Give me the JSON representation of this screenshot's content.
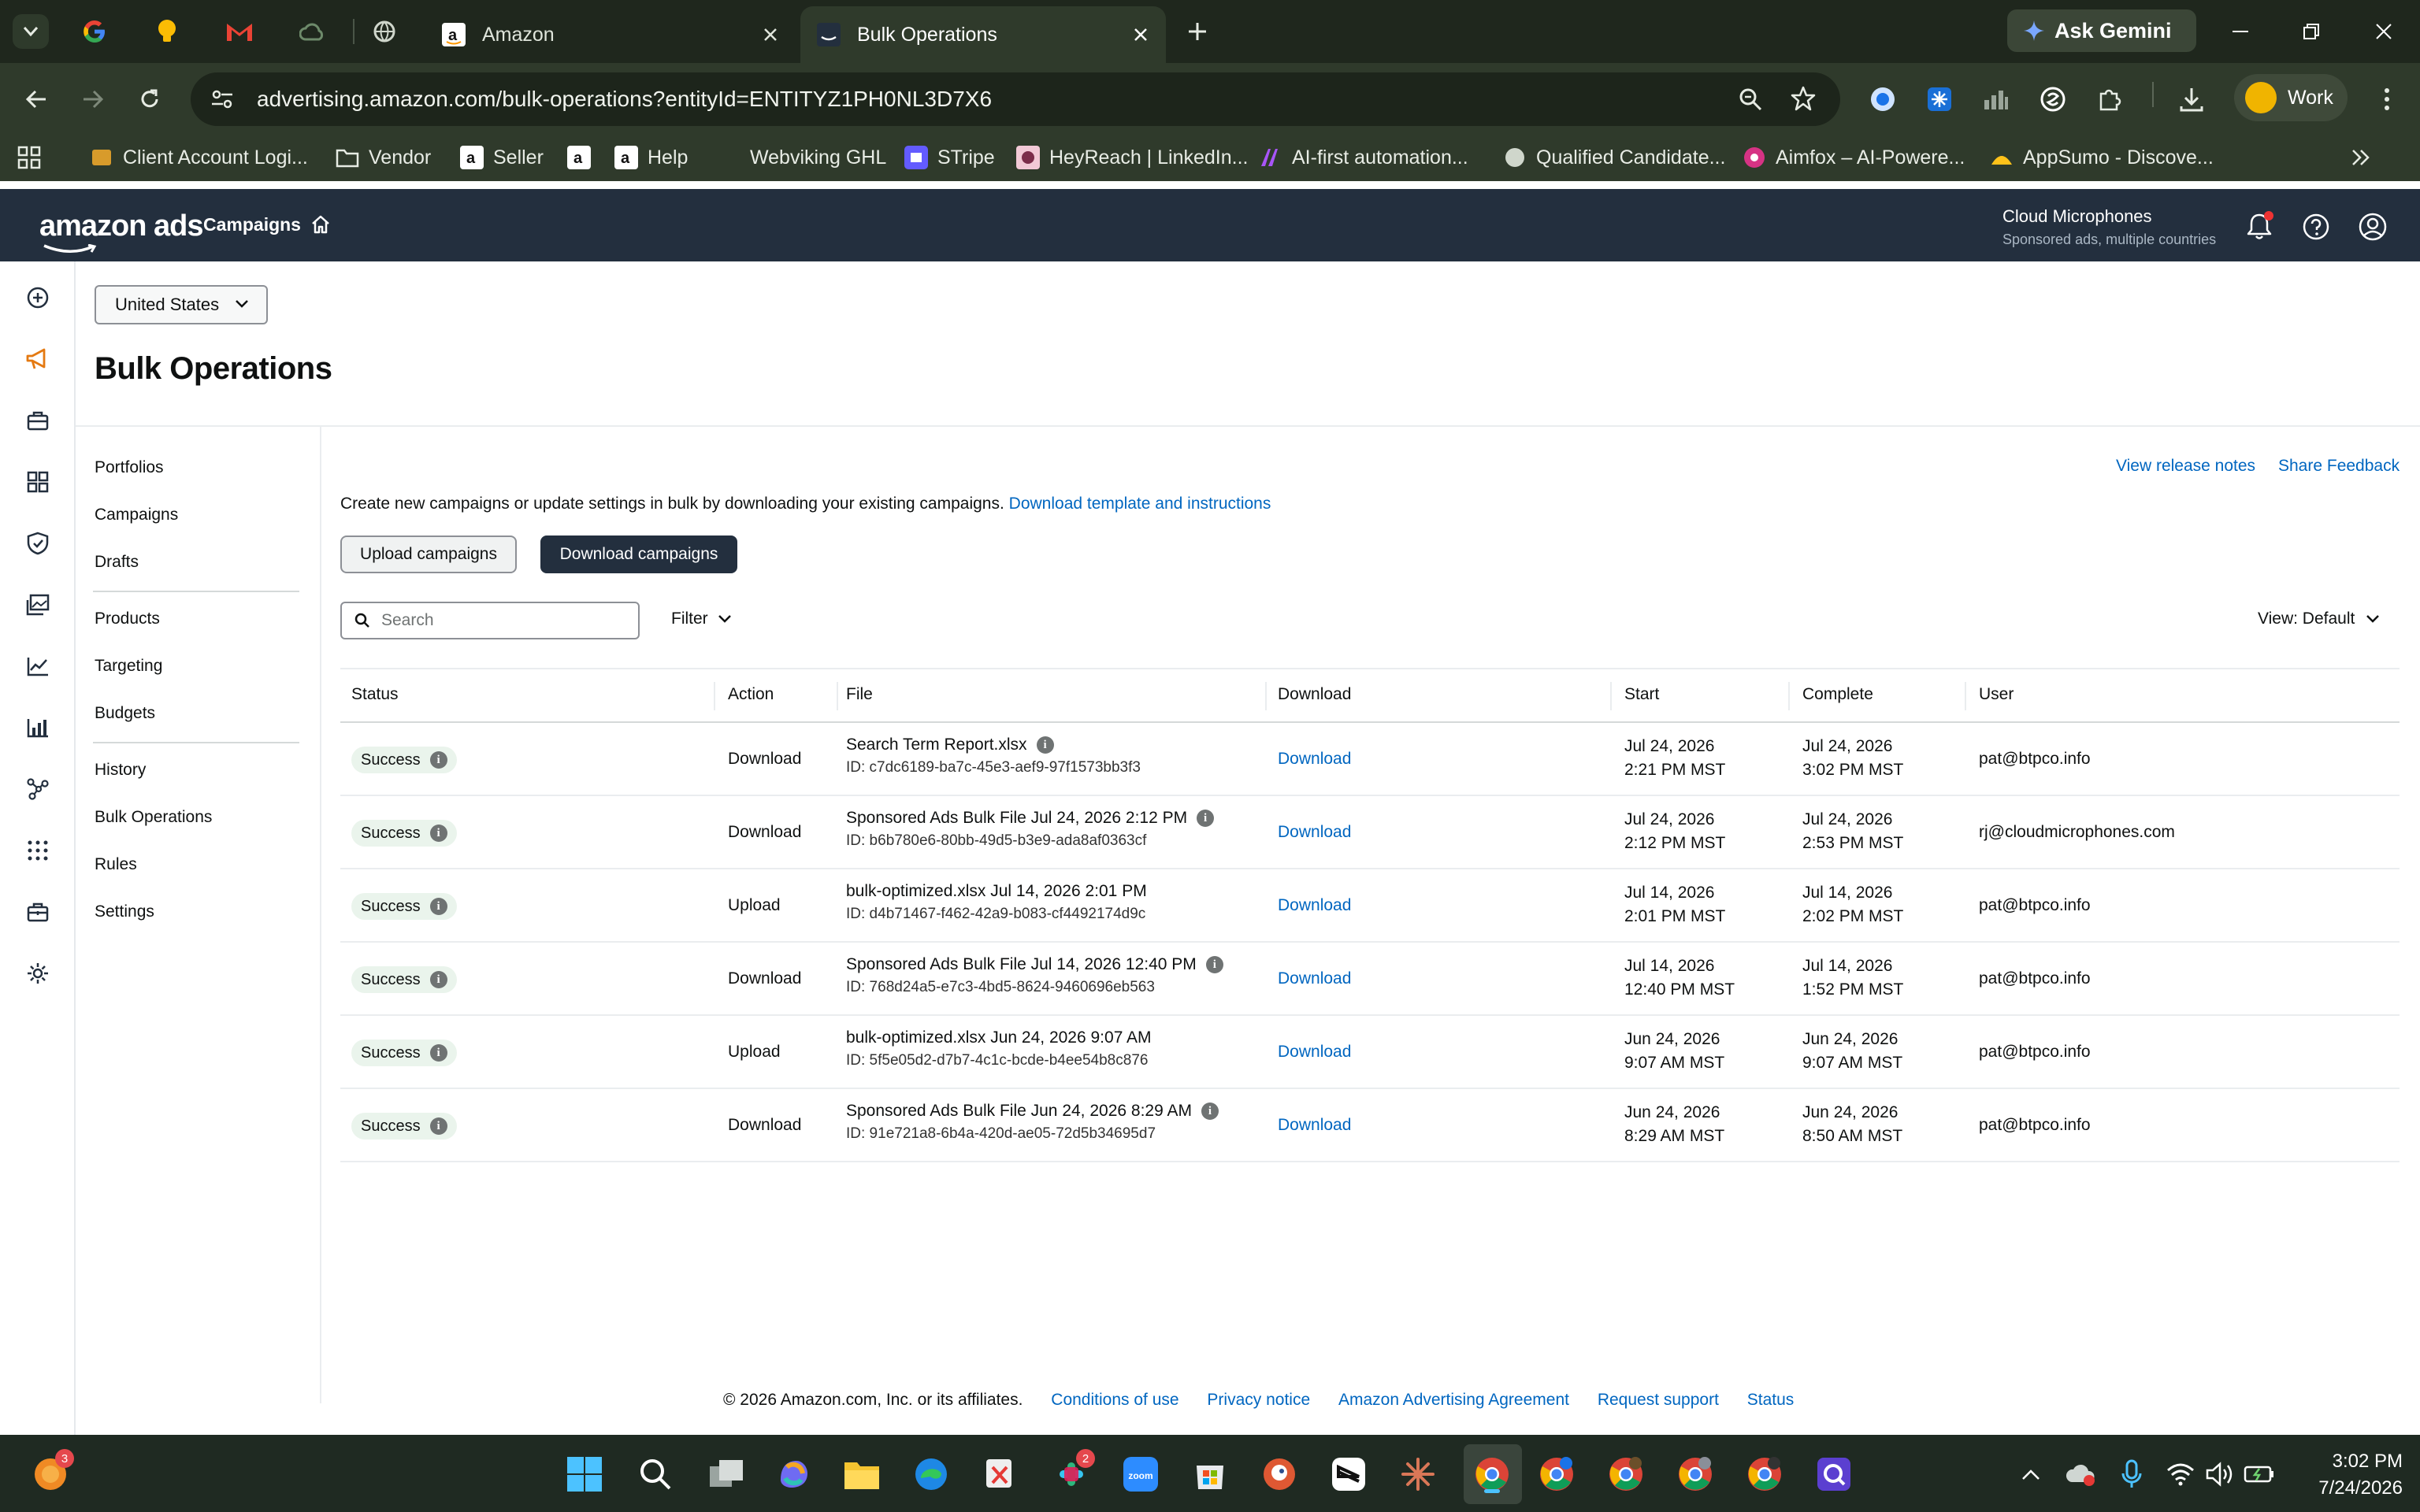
{
  "browser": {
    "tabs": [
      {
        "title": "Amazon",
        "active": false
      },
      {
        "title": "Bulk Operations",
        "active": true
      }
    ],
    "ask_gemini": "Ask Gemini",
    "url": "advertising.amazon.com/bulk-operations?entityId=ENTITYZ1PH0NL3D7X6",
    "profile": "Work",
    "bookmarks": [
      "Client Account Logi...",
      "Vendor",
      "Seller",
      "Help",
      "Webviking GHL",
      "STripe",
      "HeyReach | LinkedIn...",
      "AI-first automation...",
      "Qualified Candidate...",
      "Aimfox – AI-Powere...",
      "AppSumo - Discove..."
    ]
  },
  "ads_header": {
    "logo": "amazon ads",
    "nav_campaigns": "Campaigns",
    "account_name": "Cloud Microphones",
    "account_sub": "Sponsored ads, multiple countries"
  },
  "page": {
    "country": "United States",
    "title": "Bulk Operations",
    "view_release_notes": "View release notes",
    "share_feedback": "Share Feedback",
    "intro_text": "Create new campaigns or update settings in bulk by downloading your existing campaigns.",
    "intro_link": "Download template and instructions",
    "upload_button": "Upload campaigns",
    "download_button": "Download campaigns",
    "search_placeholder": "Search",
    "filter_label": "Filter",
    "view_label": "View: Default"
  },
  "subnav": {
    "group1": [
      "Portfolios",
      "Campaigns",
      "Drafts"
    ],
    "group2": [
      "Products",
      "Targeting",
      "Budgets"
    ],
    "group3": [
      "History",
      "Bulk Operations",
      "Rules",
      "Settings"
    ]
  },
  "table": {
    "columns": [
      "Status",
      "Action",
      "File",
      "Download",
      "Start",
      "Complete",
      "User"
    ],
    "rows": [
      {
        "status": "Success",
        "action": "Download",
        "file": "Search Term Report.xlsx",
        "file_info": true,
        "id": "ID: c7dc6189-ba7c-45e3-aef9-97f1573bb3f3",
        "download": "Download",
        "start_date": "Jul 24, 2026",
        "start_time": "2:21 PM MST",
        "complete_date": "Jul 24, 2026",
        "complete_time": "3:02 PM MST",
        "user": "pat@btpco.info"
      },
      {
        "status": "Success",
        "action": "Download",
        "file": "Sponsored Ads Bulk File Jul 24, 2026 2:12 PM",
        "file_info": true,
        "id": "ID: b6b780e6-80bb-49d5-b3e9-ada8af0363cf",
        "download": "Download",
        "start_date": "Jul 24, 2026",
        "start_time": "2:12 PM MST",
        "complete_date": "Jul 24, 2026",
        "complete_time": "2:53 PM MST",
        "user": "rj@cloudmicrophones.com"
      },
      {
        "status": "Success",
        "action": "Upload",
        "file": "bulk-optimized.xlsx Jul 14, 2026 2:01 PM",
        "file_info": false,
        "id": "ID: d4b71467-f462-42a9-b083-cf4492174d9c",
        "download": "Download",
        "start_date": "Jul 14, 2026",
        "start_time": "2:01 PM MST",
        "complete_date": "Jul 14, 2026",
        "complete_time": "2:02 PM MST",
        "user": "pat@btpco.info"
      },
      {
        "status": "Success",
        "action": "Download",
        "file": "Sponsored Ads Bulk File Jul 14, 2026 12:40 PM",
        "file_info": true,
        "id": "ID: 768d24a5-e7c3-4bd5-8624-9460696eb563",
        "download": "Download",
        "start_date": "Jul 14, 2026",
        "start_time": "12:40 PM MST",
        "complete_date": "Jul 14, 2026",
        "complete_time": "1:52 PM MST",
        "user": "pat@btpco.info"
      },
      {
        "status": "Success",
        "action": "Upload",
        "file": "bulk-optimized.xlsx Jun 24, 2026 9:07 AM",
        "file_info": false,
        "id": "ID: 5f5e05d2-d7b7-4c1c-bcde-b4ee54b8c876",
        "download": "Download",
        "start_date": "Jun 24, 2026",
        "start_time": "9:07 AM MST",
        "complete_date": "Jun 24, 2026",
        "complete_time": "9:07 AM MST",
        "user": "pat@btpco.info"
      },
      {
        "status": "Success",
        "action": "Download",
        "file": "Sponsored Ads Bulk File Jun 24, 2026 8:29 AM",
        "file_info": true,
        "id": "ID: 91e721a8-6b4a-420d-ae05-72d5b34695d7",
        "download": "Download",
        "start_date": "Jun 24, 2026",
        "start_time": "8:29 AM MST",
        "complete_date": "Jun 24, 2026",
        "complete_time": "8:50 AM MST",
        "user": "pat@btpco.info"
      }
    ]
  },
  "footer": {
    "copyright": "© 2026 Amazon.com, Inc. or its affiliates.",
    "links": [
      "Conditions of use",
      "Privacy notice",
      "Amazon Advertising Agreement",
      "Request support",
      "Status"
    ]
  },
  "taskbar": {
    "notification_badge": "3",
    "slack_badge": "2",
    "zoom_label": "zoom",
    "time": "3:02 PM",
    "date": "7/24/2026"
  },
  "colors": {
    "browser_frame": "#2f3a2b",
    "ads_header": "#232f3e",
    "link": "#0066c0",
    "success_badge": "#eaf4ec",
    "primary_button": "#232f3e"
  }
}
